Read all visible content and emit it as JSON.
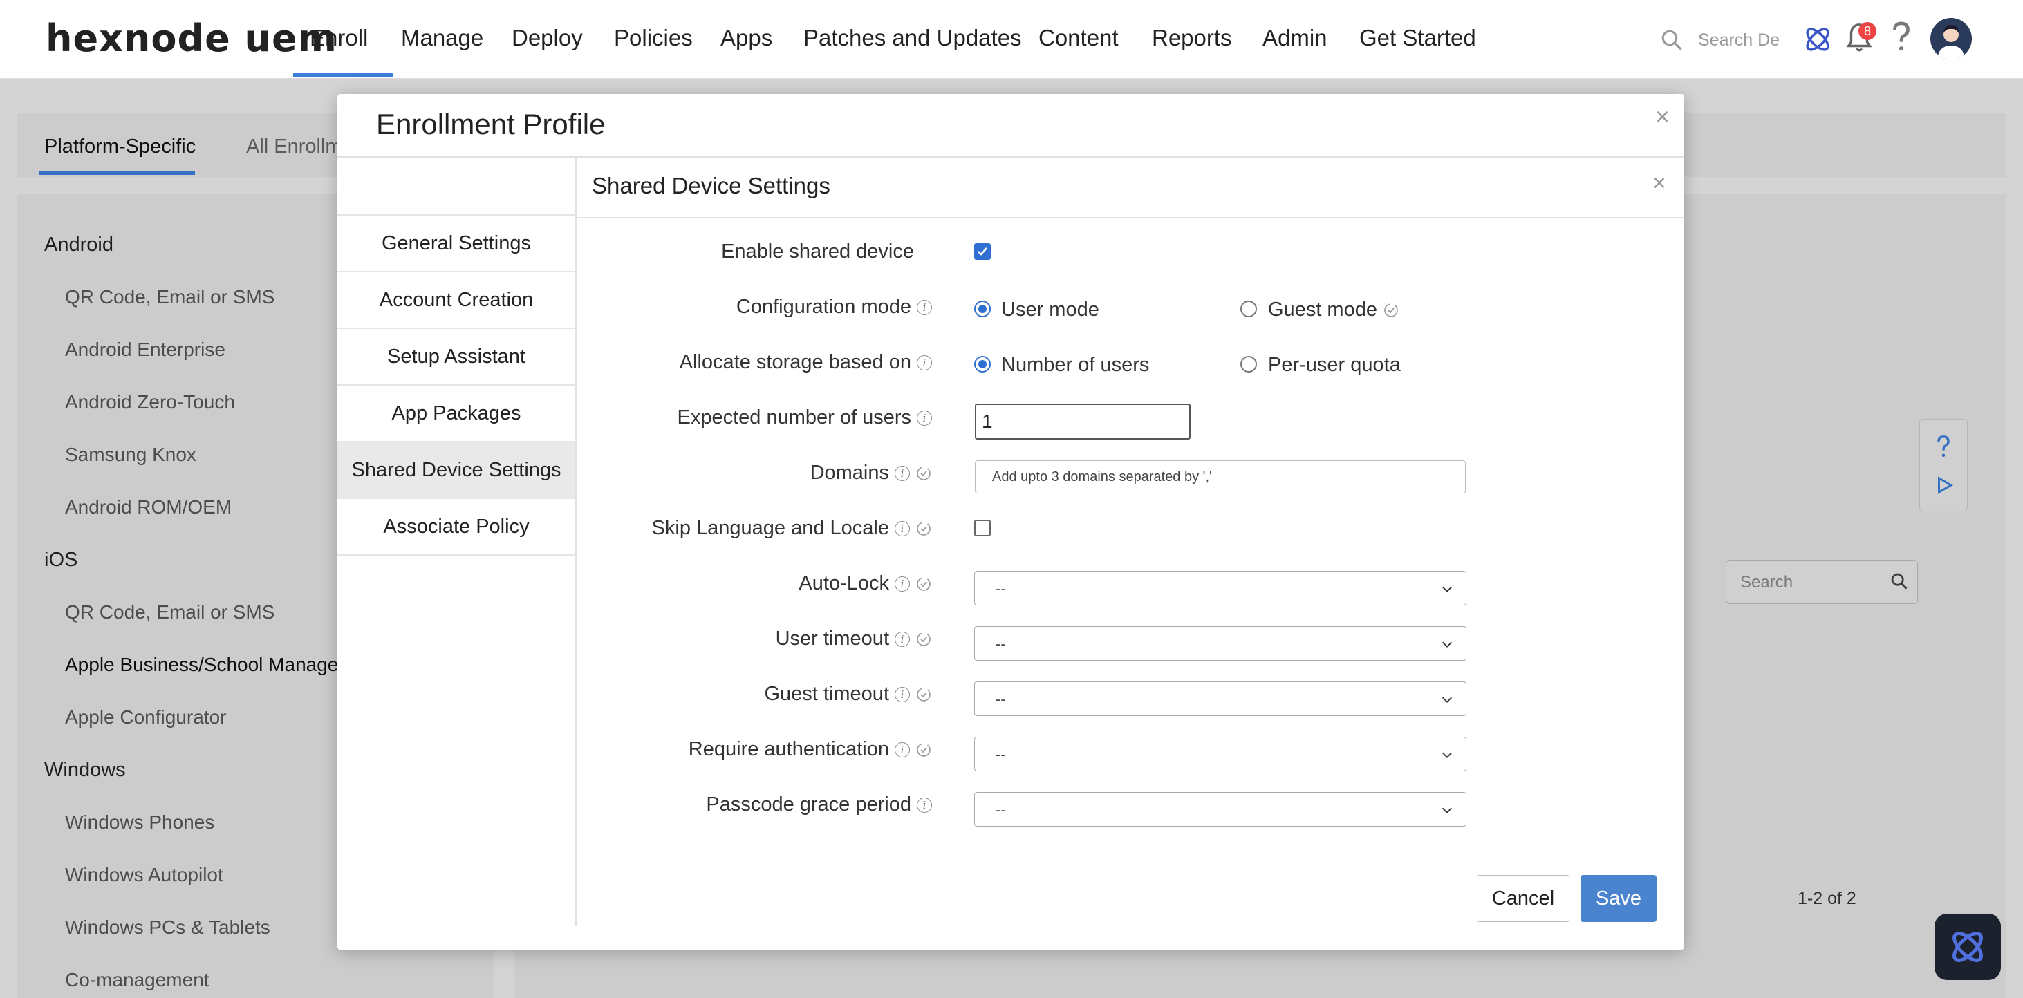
{
  "brand": {
    "logo": "hexnode uem"
  },
  "nav": {
    "items": [
      "Enroll",
      "Manage",
      "Deploy",
      "Policies",
      "Apps",
      "Patches and Updates",
      "Content",
      "Reports",
      "Admin",
      "Get Started"
    ],
    "active": "Enroll",
    "search_placeholder": "Search De",
    "notification_count": "8"
  },
  "subtabs": [
    "Platform-Specific",
    "All Enrollm"
  ],
  "sidebar": {
    "groups": [
      {
        "title": "Android",
        "items": [
          "QR Code, Email or SMS",
          "Android Enterprise",
          "Android Zero-Touch",
          "Samsung Knox",
          "Android ROM/OEM"
        ]
      },
      {
        "title": "iOS",
        "items": [
          "QR Code, Email or SMS",
          "Apple Business/School Manager",
          "Apple Configurator"
        ]
      },
      {
        "title": "Windows",
        "items": [
          "Windows Phones",
          "Windows Autopilot",
          "Windows PCs & Tablets",
          "Co-management"
        ]
      }
    ]
  },
  "background": {
    "search_placeholder": "Search",
    "pager": "1-2 of 2"
  },
  "modal": {
    "title": "Enrollment Profile",
    "nav": [
      "General Settings",
      "Account Creation",
      "Setup Assistant",
      "App Packages",
      "Shared Device Settings",
      "Associate Policy"
    ],
    "active_nav": "Shared Device Settings",
    "panel_title": "Shared Device Settings",
    "fields": {
      "enable_shared": {
        "label": "Enable shared device",
        "checked": true
      },
      "config_mode": {
        "label": "Configuration mode",
        "options": [
          "User mode",
          "Guest mode"
        ],
        "selected": "User mode"
      },
      "allocate_storage": {
        "label": "Allocate storage based on",
        "options": [
          "Number of users",
          "Per-user quota"
        ],
        "selected": "Number of users"
      },
      "expected_users": {
        "label": "Expected number of users",
        "value": "1"
      },
      "domains": {
        "label": "Domains",
        "placeholder": "Add upto 3 domains separated by ','"
      },
      "skip_language": {
        "label": "Skip Language and Locale",
        "checked": false
      },
      "auto_lock": {
        "label": "Auto-Lock",
        "value": "--"
      },
      "user_timeout": {
        "label": "User timeout",
        "value": "--"
      },
      "guest_timeout": {
        "label": "Guest timeout",
        "value": "--"
      },
      "require_auth": {
        "label": "Require authentication",
        "value": "--"
      },
      "passcode_grace": {
        "label": "Passcode grace period",
        "value": "--"
      }
    },
    "buttons": {
      "cancel": "Cancel",
      "save": "Save"
    }
  },
  "colors": {
    "accent": "#3b7dd8",
    "save_button": "#4a84cf",
    "badge": "#e44444"
  }
}
